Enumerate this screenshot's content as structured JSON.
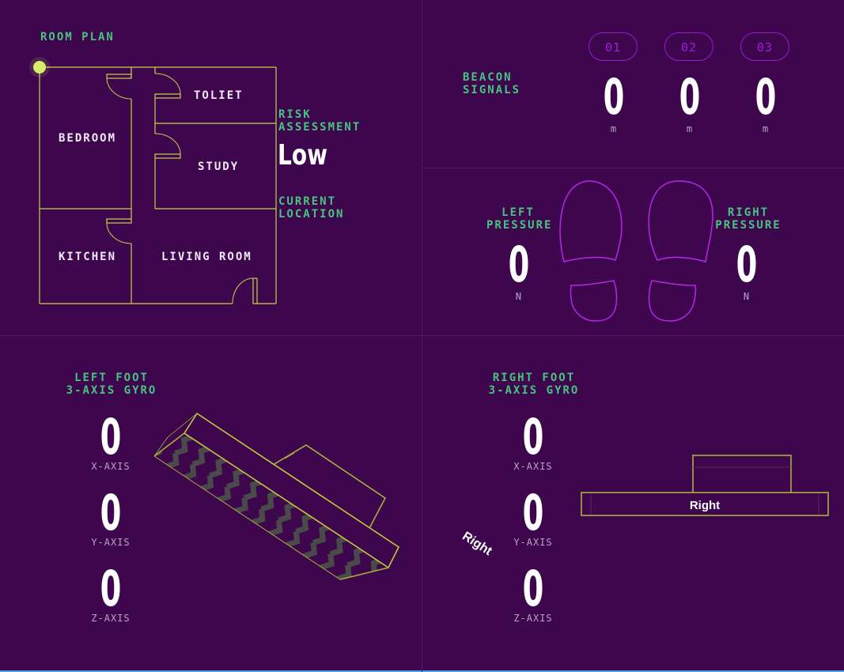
{
  "room_plan": {
    "title": "ROOM PLAN",
    "rooms": {
      "bedroom": "BEDROOM",
      "toilet": "TOLIET",
      "study": "STUDY",
      "kitchen": "KITCHEN",
      "living_room": "LIVING ROOM"
    },
    "risk_assessment_label": "RISK\nASSESSMENT",
    "risk_assessment_value": "Low",
    "current_location_label": "CURRENT\nLOCATION",
    "colors": {
      "wall": "#c9d24a",
      "marker": "#d8ee6a"
    }
  },
  "beacon_signals": {
    "title": "BEACON\nSIGNALS",
    "beacons": [
      {
        "id": "01",
        "value": "0",
        "unit": "m"
      },
      {
        "id": "02",
        "value": "0",
        "unit": "m"
      },
      {
        "id": "03",
        "value": "0",
        "unit": "m"
      }
    ]
  },
  "pressure": {
    "left": {
      "label": "LEFT\nPRESSURE",
      "value": "0",
      "unit": "N"
    },
    "right": {
      "label": "RIGHT\nPRESSURE",
      "value": "0",
      "unit": "N"
    },
    "colors": {
      "footprint": "#b526e8"
    }
  },
  "left_gyro": {
    "title": "LEFT FOOT\n3-AXIS GYRO",
    "axes": [
      {
        "value": "0",
        "label": "X-AXIS"
      },
      {
        "value": "0",
        "label": "Y-AXIS"
      },
      {
        "value": "0",
        "label": "Z-AXIS"
      }
    ],
    "model_label": "Right"
  },
  "right_gyro": {
    "title": "RIGHT FOOT\n3-AXIS GYRO",
    "axes": [
      {
        "value": "0",
        "label": "X-AXIS"
      },
      {
        "value": "0",
        "label": "Y-AXIS"
      },
      {
        "value": "0",
        "label": "Z-AXIS"
      }
    ],
    "model_label": "Right"
  },
  "theme": {
    "background": "#3d064d",
    "accent_green": "#47c47f",
    "accent_purple": "#a01ee0",
    "divider": "#5a1470"
  }
}
